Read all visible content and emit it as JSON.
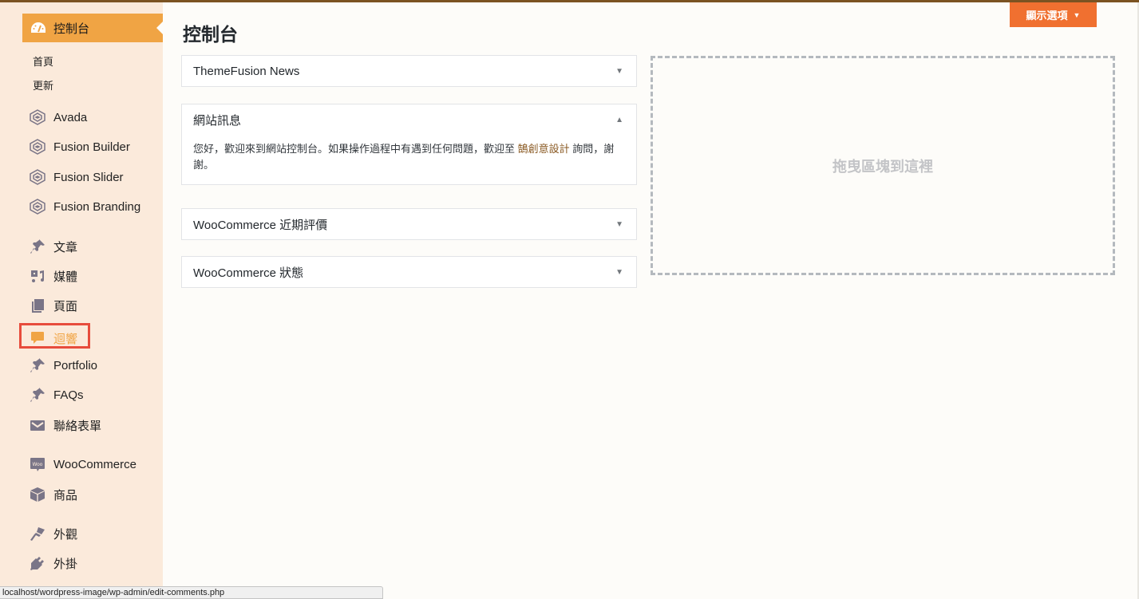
{
  "colors": {
    "top_bar": "#7b5322",
    "sidebar_bg": "#fbeadb",
    "menu_current_bg": "#f0a444",
    "highlight_text": "#f0a444",
    "highlight_box": "#e74c3c",
    "screen_options_bg": "#f07030",
    "link": "#8a5a23",
    "icon_gray": "#7a7587"
  },
  "sidebar": {
    "current": {
      "label": "控制台",
      "icon": "dashboard-gauge-icon"
    },
    "submenu": [
      {
        "label": "首頁"
      },
      {
        "label": "更新"
      }
    ],
    "items": [
      {
        "label": "Avada",
        "icon": "avada-icon"
      },
      {
        "label": "Fusion Builder",
        "icon": "avada-icon"
      },
      {
        "label": "Fusion Slider",
        "icon": "avada-icon"
      },
      {
        "label": "Fusion Branding",
        "icon": "avada-icon"
      },
      {
        "label": "文章",
        "icon": "pushpin-icon"
      },
      {
        "label": "媒體",
        "icon": "media-icon"
      },
      {
        "label": "頁面",
        "icon": "pages-icon"
      },
      {
        "label": "迴響",
        "icon": "comment-bubble-icon",
        "highlighted": true
      },
      {
        "label": "Portfolio",
        "icon": "pushpin-icon"
      },
      {
        "label": "FAQs",
        "icon": "pushpin-icon"
      },
      {
        "label": "聯絡表單",
        "icon": "envelope-icon"
      },
      {
        "label": "WooCommerce",
        "icon": "woocommerce-icon"
      },
      {
        "label": "商品",
        "icon": "product-box-icon"
      },
      {
        "label": "外觀",
        "icon": "paintbrush-icon"
      },
      {
        "label": "外掛",
        "icon": "plugin-icon"
      }
    ]
  },
  "header": {
    "page_title": "控制台",
    "screen_options_label": "顯示選項",
    "screen_options_caret": "▼"
  },
  "widgets": [
    {
      "title": "ThemeFusion News",
      "toggle": "▼",
      "expanded": false
    },
    {
      "title": "網站訊息",
      "toggle": "▲",
      "expanded": true,
      "body_prefix": "您好，歡迎來到網站控制台。如果操作過程中有遇到任何問題，歡迎至 ",
      "body_link": "鵠創意設計",
      "body_suffix": " 詢問，謝謝。"
    },
    {
      "title": "WooCommerce 近期評價",
      "toggle": "▼",
      "expanded": false
    },
    {
      "title": "WooCommerce 狀態",
      "toggle": "▼",
      "expanded": false
    }
  ],
  "dropzone": {
    "text": "拖曳區塊到這裡"
  },
  "status_bar": {
    "url": "localhost/wordpress-image/wp-admin/edit-comments.php"
  }
}
